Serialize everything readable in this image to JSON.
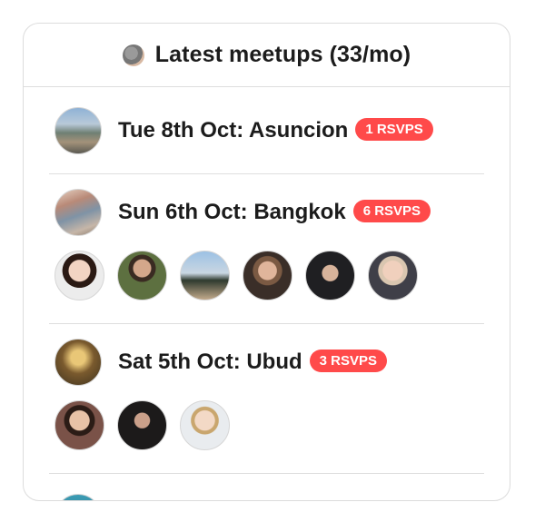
{
  "header": {
    "title": "Latest meetups (33/mo)",
    "icon": "globe-icon"
  },
  "meetups": [
    {
      "title": "Tue 8th Oct: Asuncion",
      "rsvps": "1 RSVPS",
      "attendee_count": 0
    },
    {
      "title": "Sun 6th Oct: Bangkok",
      "rsvps": "6 RSVPS",
      "attendee_count": 6
    },
    {
      "title": "Sat 5th Oct: Ubud",
      "rsvps": "3 RSVPS",
      "attendee_count": 3
    }
  ],
  "colors": {
    "badge": "#ff4a4a",
    "text": "#1c1c1c",
    "border": "#dcdcdc"
  }
}
